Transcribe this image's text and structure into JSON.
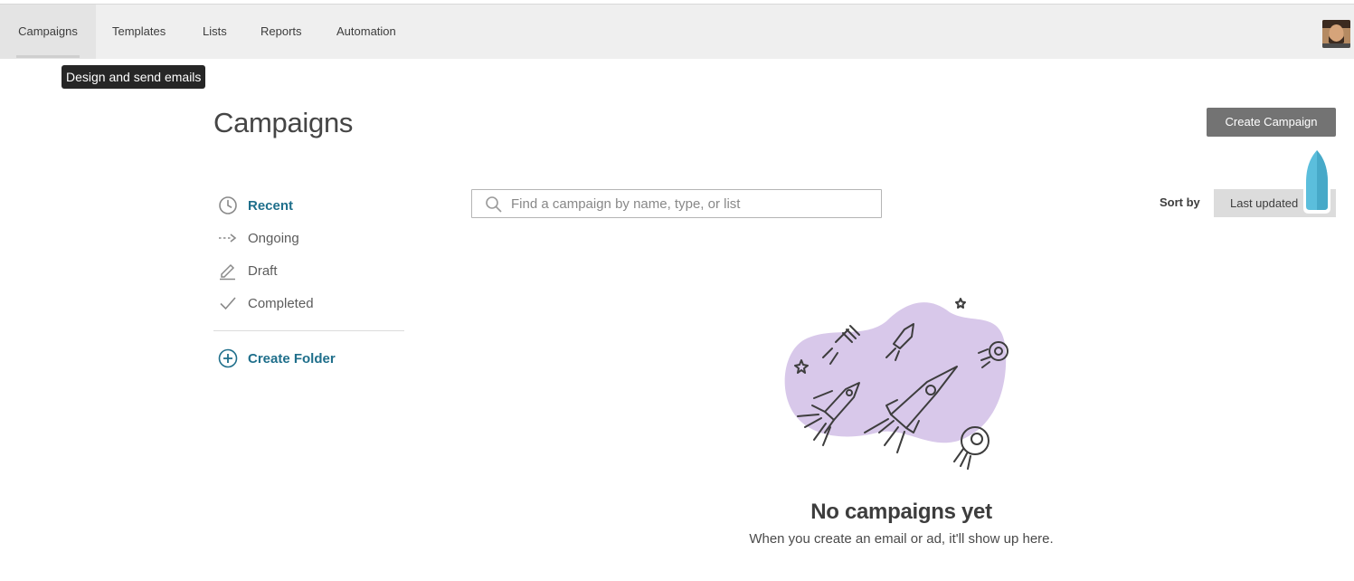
{
  "topnav": {
    "items": [
      {
        "label": "Campaigns",
        "active": true
      },
      {
        "label": "Templates"
      },
      {
        "label": "Lists"
      },
      {
        "label": "Reports"
      },
      {
        "label": "Automation"
      }
    ],
    "avatar_icon": "user-avatar"
  },
  "tooltip": {
    "text": "Design and send emails"
  },
  "page": {
    "title": "Campaigns"
  },
  "actions": {
    "create_campaign": "Create Campaign"
  },
  "sidebar": {
    "items": [
      {
        "label": "Recent",
        "icon": "clock-icon",
        "active": true
      },
      {
        "label": "Ongoing",
        "icon": "dashed-arrow-icon"
      },
      {
        "label": "Draft",
        "icon": "pencil-icon"
      },
      {
        "label": "Completed",
        "icon": "checkmark-icon"
      }
    ],
    "create_folder": "Create Folder"
  },
  "search": {
    "placeholder": "Find a campaign by name, type, or list",
    "value": ""
  },
  "sort": {
    "label": "Sort by",
    "selected": "Last updated"
  },
  "empty_state": {
    "title": "No campaigns yet",
    "subtitle": "When you create an email or ad, it'll show up here.",
    "illustration": "rockets-illustration"
  },
  "colors": {
    "accent_link": "#1f6f8b",
    "button_bg": "#737373",
    "nav_bg": "#efefef",
    "blob": "#d8c8ea",
    "cursor_marker": "#5bbedc"
  }
}
